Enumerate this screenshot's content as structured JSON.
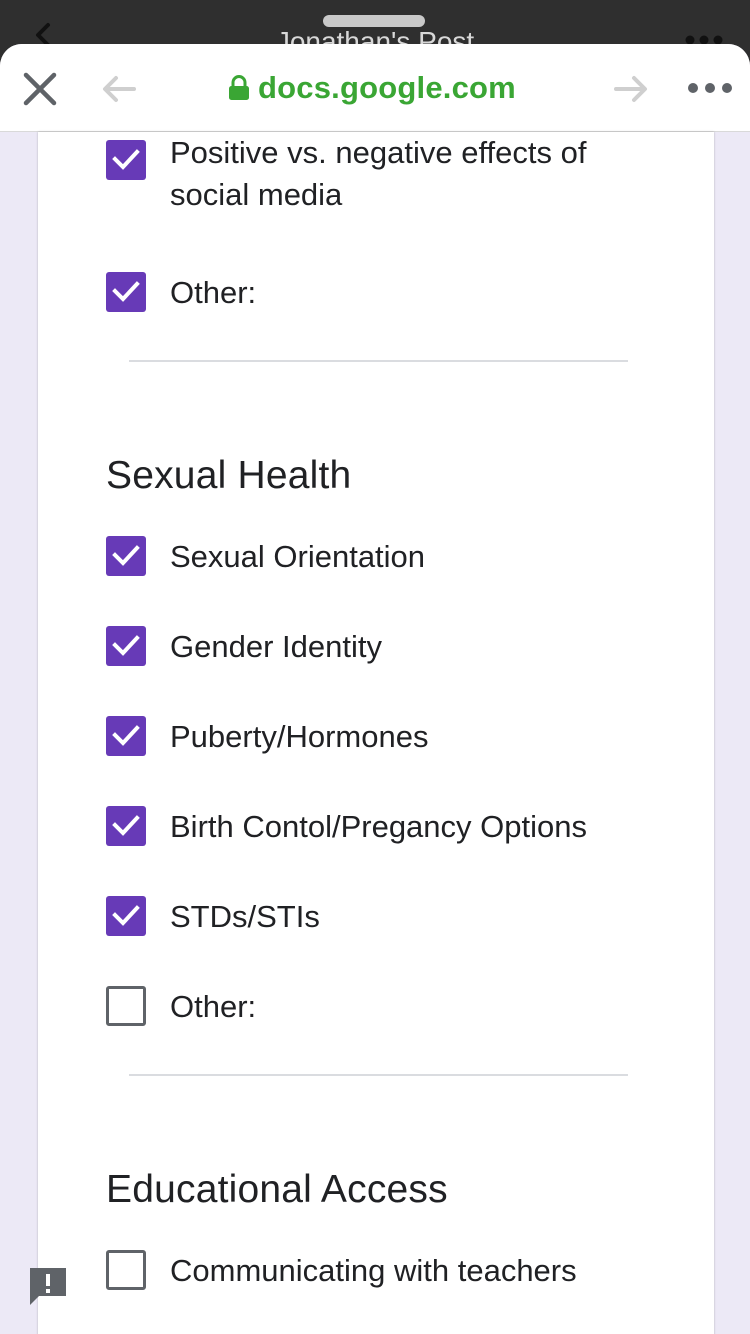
{
  "underlying_app": {
    "title": "Jonathan's Post"
  },
  "browser": {
    "url": "docs.google.com",
    "icons": {
      "close": "close-icon",
      "back": "arrow-left-icon",
      "forward": "arrow-right-icon",
      "more": "more-horizontal-icon",
      "lock": "lock-icon"
    }
  },
  "form": {
    "accent_color": "#673ab7",
    "prev_section_options": [
      {
        "label": "Positive vs. negative effects of social media",
        "checked": true
      },
      {
        "label": "Other:",
        "checked": true
      }
    ],
    "sexual_health": {
      "title": "Sexual Health",
      "options": [
        {
          "label": "Sexual Orientation",
          "checked": true
        },
        {
          "label": "Gender Identity",
          "checked": true
        },
        {
          "label": "Puberty/Hormones",
          "checked": true
        },
        {
          "label": "Birth Contol/Pregancy Options",
          "checked": true
        },
        {
          "label": "STDs/STIs",
          "checked": true
        },
        {
          "label": "Other:",
          "checked": false
        }
      ]
    },
    "educational_access": {
      "title": "Educational Access",
      "options": [
        {
          "label": "Communicating with teachers",
          "checked": false
        }
      ]
    }
  },
  "feedback_icon": "report-feedback-icon"
}
